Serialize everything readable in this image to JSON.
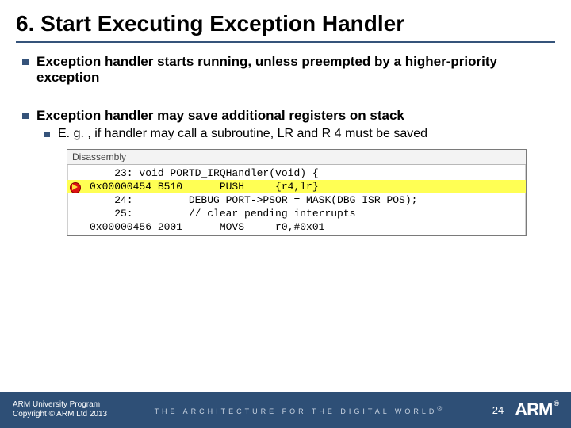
{
  "title": "6. Start Executing Exception Handler",
  "bullets": {
    "b1": "Exception handler starts running, unless preempted by a higher-priority exception",
    "b2": "Exception handler may save additional registers on stack",
    "b2_1": "E. g. , if handler may call a subroutine, LR and R 4 must be saved"
  },
  "disasm": {
    "title": "Disassembly",
    "rows": [
      "    23: void PORTD_IRQHandler(void) {",
      "0x00000454 B510      PUSH     {r4,lr}",
      "    24:         DEBUG_PORT->PSOR = MASK(DBG_ISR_POS);",
      "    25:         // clear pending interrupts",
      "0x00000456 2001      MOVS     r0,#0x01"
    ]
  },
  "footer": {
    "line1": "ARM University Program",
    "line2": "Copyright © ARM Ltd 2013",
    "tagline": "THE ARCHITECTURE FOR THE DIGITAL WORLD",
    "page": "24",
    "logo": "ARM"
  }
}
